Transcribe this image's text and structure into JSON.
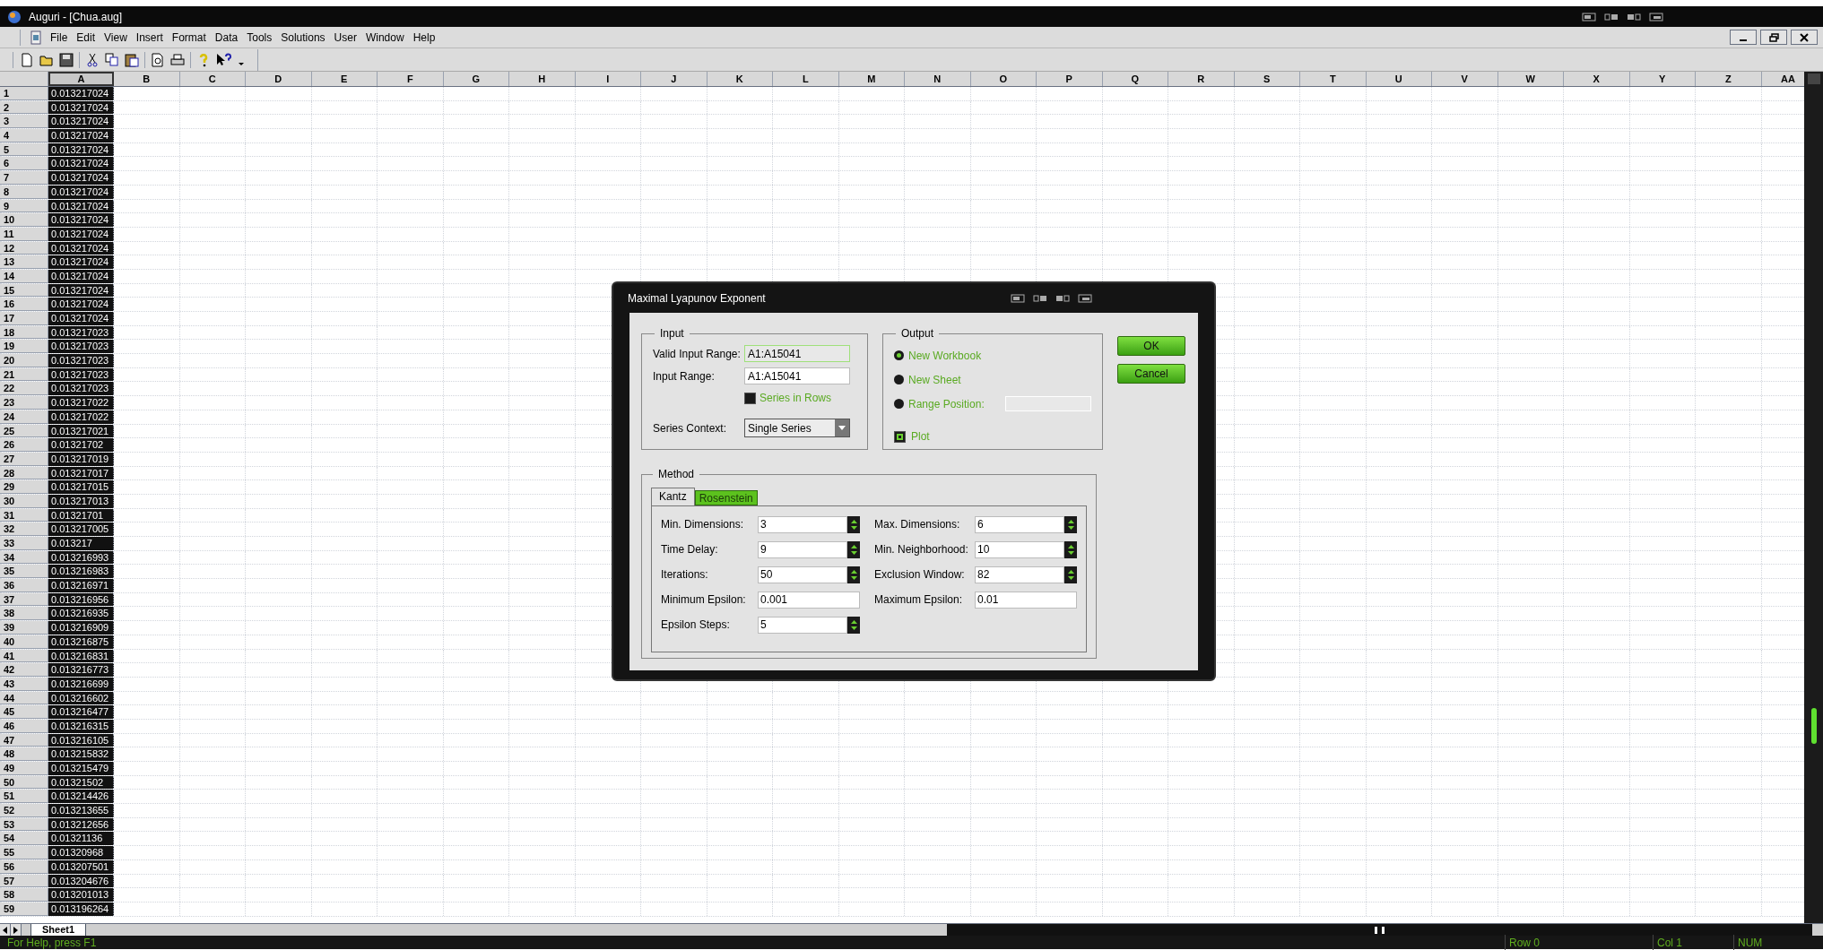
{
  "window": {
    "title": "Auguri - [Chua.aug]"
  },
  "menu": [
    "File",
    "Edit",
    "View",
    "Insert",
    "Format",
    "Data",
    "Tools",
    "Solutions",
    "User",
    "Window",
    "Help"
  ],
  "sheet": {
    "columns": [
      {
        "label": "A",
        "selected": true
      },
      {
        "label": "B",
        "selected": false
      },
      {
        "label": "C",
        "selected": false
      },
      {
        "label": "D",
        "selected": false
      },
      {
        "label": "E",
        "selected": false
      },
      {
        "label": "F",
        "selected": false
      },
      {
        "label": "G",
        "selected": false
      },
      {
        "label": "H",
        "selected": false
      },
      {
        "label": "I",
        "selected": false
      },
      {
        "label": "J",
        "selected": false
      },
      {
        "label": "K",
        "selected": false
      },
      {
        "label": "L",
        "selected": false
      },
      {
        "label": "M",
        "selected": false
      },
      {
        "label": "N",
        "selected": false
      },
      {
        "label": "O",
        "selected": false
      },
      {
        "label": "P",
        "selected": false
      },
      {
        "label": "Q",
        "selected": false
      },
      {
        "label": "R",
        "selected": false
      },
      {
        "label": "S",
        "selected": false
      },
      {
        "label": "T",
        "selected": false
      },
      {
        "label": "U",
        "selected": false
      },
      {
        "label": "V",
        "selected": false
      },
      {
        "label": "W",
        "selected": false
      },
      {
        "label": "X",
        "selected": false
      },
      {
        "label": "Y",
        "selected": false
      },
      {
        "label": "Z",
        "selected": false
      },
      {
        "label": "AA",
        "selected": false
      }
    ],
    "rows": [
      {
        "number": "1",
        "value": "0.013217024"
      },
      {
        "number": "2",
        "value": "0.013217024"
      },
      {
        "number": "3",
        "value": "0.013217024"
      },
      {
        "number": "4",
        "value": "0.013217024"
      },
      {
        "number": "5",
        "value": "0.013217024"
      },
      {
        "number": "6",
        "value": "0.013217024"
      },
      {
        "number": "7",
        "value": "0.013217024"
      },
      {
        "number": "8",
        "value": "0.013217024"
      },
      {
        "number": "9",
        "value": "0.013217024"
      },
      {
        "number": "10",
        "value": "0.013217024"
      },
      {
        "number": "11",
        "value": "0.013217024"
      },
      {
        "number": "12",
        "value": "0.013217024"
      },
      {
        "number": "13",
        "value": "0.013217024"
      },
      {
        "number": "14",
        "value": "0.013217024"
      },
      {
        "number": "15",
        "value": "0.013217024"
      },
      {
        "number": "16",
        "value": "0.013217024"
      },
      {
        "number": "17",
        "value": "0.013217024"
      },
      {
        "number": "18",
        "value": "0.013217023"
      },
      {
        "number": "19",
        "value": "0.013217023"
      },
      {
        "number": "20",
        "value": "0.013217023"
      },
      {
        "number": "21",
        "value": "0.013217023"
      },
      {
        "number": "22",
        "value": "0.013217023"
      },
      {
        "number": "23",
        "value": "0.013217022"
      },
      {
        "number": "24",
        "value": "0.013217022"
      },
      {
        "number": "25",
        "value": "0.013217021"
      },
      {
        "number": "26",
        "value": "0.01321702"
      },
      {
        "number": "27",
        "value": "0.013217019"
      },
      {
        "number": "28",
        "value": "0.013217017"
      },
      {
        "number": "29",
        "value": "0.013217015"
      },
      {
        "number": "30",
        "value": "0.013217013"
      },
      {
        "number": "31",
        "value": "0.01321701"
      },
      {
        "number": "32",
        "value": "0.013217005"
      },
      {
        "number": "33",
        "value": "0.013217"
      },
      {
        "number": "34",
        "value": "0.013216993"
      },
      {
        "number": "35",
        "value": "0.013216983"
      },
      {
        "number": "36",
        "value": "0.013216971"
      },
      {
        "number": "37",
        "value": "0.013216956"
      },
      {
        "number": "38",
        "value": "0.013216935"
      },
      {
        "number": "39",
        "value": "0.013216909"
      },
      {
        "number": "40",
        "value": "0.013216875"
      },
      {
        "number": "41",
        "value": "0.013216831"
      },
      {
        "number": "42",
        "value": "0.013216773"
      },
      {
        "number": "43",
        "value": "0.013216699"
      },
      {
        "number": "44",
        "value": "0.013216602"
      },
      {
        "number": "45",
        "value": "0.013216477"
      },
      {
        "number": "46",
        "value": "0.013216315"
      },
      {
        "number": "47",
        "value": "0.013216105"
      },
      {
        "number": "48",
        "value": "0.013215832"
      },
      {
        "number": "49",
        "value": "0.013215479"
      },
      {
        "number": "50",
        "value": "0.01321502"
      },
      {
        "number": "51",
        "value": "0.013214426"
      },
      {
        "number": "52",
        "value": "0.013213655"
      },
      {
        "number": "53",
        "value": "0.013212656"
      },
      {
        "number": "54",
        "value": "0.01321136"
      },
      {
        "number": "55",
        "value": "0.01320968"
      },
      {
        "number": "56",
        "value": "0.013207501"
      },
      {
        "number": "57",
        "value": "0.013204676"
      },
      {
        "number": "58",
        "value": "0.013201013"
      },
      {
        "number": "59",
        "value": "0.013196264"
      }
    ],
    "tabs": [
      {
        "label": "Sheet1",
        "selected": true
      }
    ]
  },
  "dialog": {
    "title": "Maximal Lyapunov Exponent",
    "input": {
      "legend": "Input",
      "valid_label": "Valid Input Range:",
      "valid_value": "A1:A15041",
      "range_label": "Input Range:",
      "range_value": "A1:A15041",
      "series_in_rows": {
        "label": "Series in Rows",
        "checked": false
      },
      "context_label": "Series Context:",
      "context_value": "Single Series"
    },
    "output": {
      "legend": "Output",
      "options": [
        {
          "label": "New Workbook",
          "selected": true
        },
        {
          "label": "New Sheet",
          "selected": false
        },
        {
          "label": "Range Position:",
          "selected": false
        }
      ],
      "plot": {
        "label": "Plot",
        "checked": true
      }
    },
    "buttons": [
      "OK",
      "Cancel"
    ],
    "method": {
      "legend": "Method",
      "tabs": [
        {
          "label": "Kantz",
          "selected": true
        },
        {
          "label": "Rosenstein",
          "selected": false
        }
      ],
      "fields": [
        {
          "label": "Min. Dimensions:",
          "value": "3",
          "kind": "spin"
        },
        {
          "label": "Max. Dimensions:",
          "value": "6",
          "kind": "spin"
        },
        {
          "label": "Time Delay:",
          "value": "9",
          "kind": "spin"
        },
        {
          "label": "Min. Neighborhood:",
          "value": "10",
          "kind": "spin"
        },
        {
          "label": "Iterations:",
          "value": "50",
          "kind": "spin"
        },
        {
          "label": "Exclusion Window:",
          "value": "82",
          "kind": "spin"
        },
        {
          "label": "Minimum Epsilon:",
          "value": "0.001",
          "kind": "text"
        },
        {
          "label": "Maximum Epsilon:",
          "value": "0.01",
          "kind": "text"
        },
        {
          "label": "Epsilon Steps:",
          "value": "5",
          "kind": "spin"
        }
      ]
    }
  },
  "status_bar": {
    "help": "For Help, press F1",
    "row": "Row 0",
    "col": "Col 1",
    "num": "NUM"
  }
}
